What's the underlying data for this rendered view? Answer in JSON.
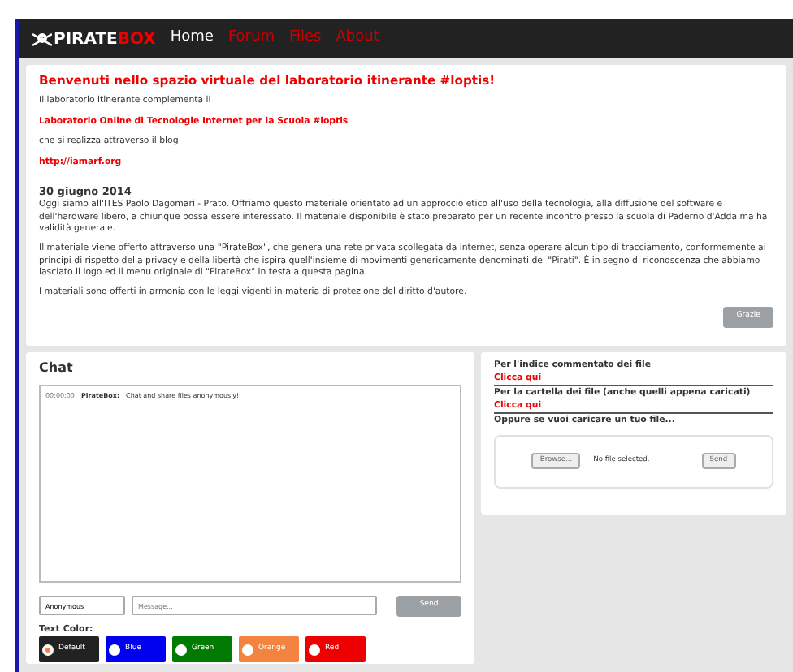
{
  "navbar": {
    "logo_left": "PIRATE",
    "logo_right": "BOX",
    "links": [
      {
        "label": "Home",
        "selected": true
      },
      {
        "label": "Forum",
        "selected": false
      },
      {
        "label": "Files",
        "selected": false
      },
      {
        "label": "About",
        "selected": false
      }
    ]
  },
  "intro": {
    "title": "Benvenuti nello spazio virtuale del laboratorio itinerante #loptis!",
    "line_1": "Il laboratorio itinerante complementa il",
    "subtitle": "Laboratorio Online di Tecnologie Internet per la Scuola #loptis",
    "line_2": "che si realizza attraverso il blog",
    "link": "http://iamarf.org",
    "date": "30 giugno 2014",
    "paragraphs": [
      "Oggi siamo all'ITES Paolo Dagomari - Prato. Offriamo questo materiale orientato ad un approccio etico all'uso della tecnologia, alla diffusione del software e dell'hardware libero, a chiunque possa essere interessato. Il materiale disponibile è stato preparato per un recente incontro presso la scuola di Paderno d'Adda ma ha validità generale.",
      "Il materiale viene offerto attraverso una \"PirateBox\", che genera una rete privata scollegata da internet, senza operare alcun tipo di tracciamento, conformemente ai principi di rispetto della privacy e della libertà che ispira quell'insieme di movimenti genericamente denominati dei \"Pirati\". È in segno di riconoscenza che abbiamo lasciato il logo ed il menu originale di \"PirateBox\" in testa a questa pagina.",
      "I materiali sono offerti in armonia con le leggi vigenti in materia di protezione del diritto d'autore."
    ],
    "button": "Grazie"
  },
  "chat": {
    "title": "Chat",
    "messages": [
      {
        "time": "00:00:00",
        "author": "PirateBox:",
        "text": "Chat and share files anonymously!"
      }
    ],
    "name_value": "Anonymous",
    "message_placeholder": "Message...",
    "send": "Send",
    "color_label": "Text Color:",
    "colors": [
      {
        "label": "Default",
        "color": "#222222",
        "selected": true
      },
      {
        "label": "Blue",
        "color": "#0000ee",
        "selected": false
      },
      {
        "label": "Green",
        "color": "#007a00",
        "selected": false
      },
      {
        "label": "Orange",
        "color": "#f58340",
        "selected": false
      },
      {
        "label": "Red",
        "color": "#ee0000",
        "selected": false
      }
    ]
  },
  "files": {
    "index_label": "Per l'indice commentato dei file",
    "index_link": "Clicca qui",
    "folder_label": "Per la cartella dei file (anche quelli appena caricati)",
    "folder_link": "Clicca qui",
    "upload_label": "Oppure se vuoi caricare un tuo file...",
    "browse": "Browse...",
    "no_file": "No file selected.",
    "send": "Send"
  }
}
